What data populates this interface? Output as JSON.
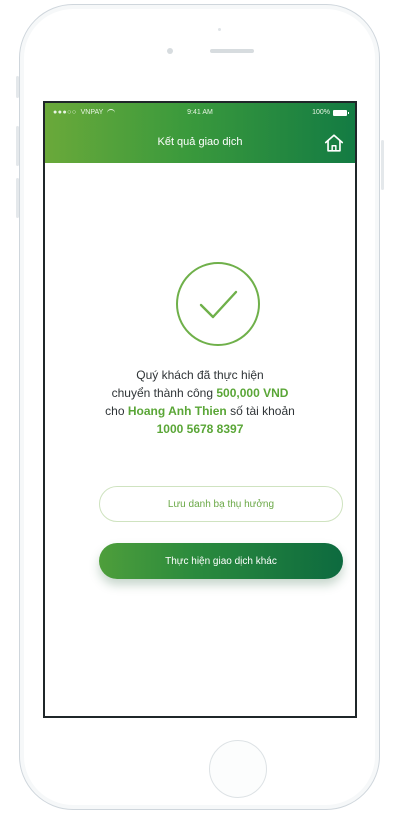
{
  "status_bar": {
    "carrier": "VNPAY",
    "time": "9:41 AM",
    "battery": "100%"
  },
  "header": {
    "title": "Kết quả giao dịch",
    "home_icon": "home-icon"
  },
  "result": {
    "icon": "check-circle-icon",
    "line1": "Quý khách đã thực hiện",
    "line2_prefix": "chuyển thành công",
    "amount": "500,000 VND",
    "line3_prefix": "cho",
    "recipient": "Hoang Anh Thien",
    "line3_suffix": "số tài khoản",
    "account_number": "1000 5678 8397"
  },
  "actions": {
    "save_beneficiary": "Lưu danh bạ thụ hưởng",
    "new_transaction": "Thực hiện giao dịch khác"
  },
  "colors": {
    "accent": "#5aa637",
    "dark_green": "#137b43"
  }
}
